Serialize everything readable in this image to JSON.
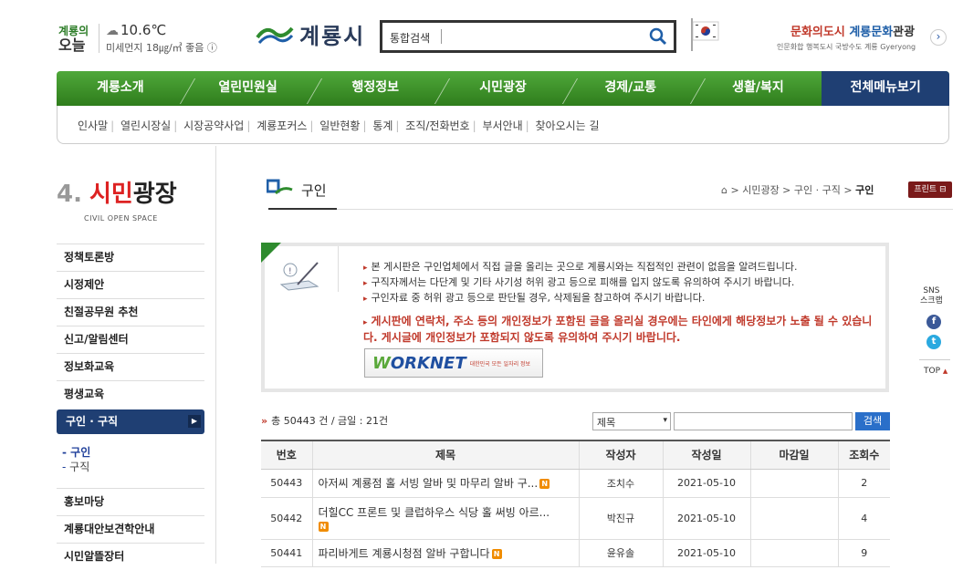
{
  "header": {
    "weather_city": "계룡의",
    "weather_today": "오늘",
    "temperature": "10.6℃",
    "dust": "미세먼지 18㎍/㎥ 좋음 ⓘ",
    "logo_text": "계룡시",
    "search_placeholder": "통합검색",
    "tour_line1_a": "문화의도시 ",
    "tour_line1_b": "계룡문화",
    "tour_line1_c": "관광",
    "tour_line2": "인문화합 행복도시 국방수도 계룡  Gyeryong"
  },
  "menu": [
    "계룡소개",
    "열린민원실",
    "행정정보",
    "시민광장",
    "경제/교통",
    "생활/복지",
    "전체메뉴보기"
  ],
  "submenu": [
    "인사말",
    "열린시장실",
    "시장공약사업",
    "계룡포커스",
    "일반현황",
    "통계",
    "조직/전화번호",
    "부서안내",
    "찾아오시는 길"
  ],
  "section": {
    "number": "4.",
    "title_red": "시민",
    "title_black": "광장",
    "english": "CIVIL OPEN SPACE"
  },
  "left_menu": [
    "정책토론방",
    "시정제안",
    "친절공무원 추천",
    "신고/알림센터",
    "정보화교육",
    "평생교육"
  ],
  "left_active": "구인 · 구직",
  "left_sub": [
    "구인",
    "구직"
  ],
  "left_menu_bottom": [
    "홍보마당",
    "계룡대안보견학안내",
    "시민알뜰장터"
  ],
  "content": {
    "title": "구인",
    "breadcrumb_1": "시민광장",
    "breadcrumb_2": "구인 · 구직",
    "breadcrumb_3": "구인",
    "print_label": "프린트 ⊟"
  },
  "notice": {
    "lines": [
      "본 게시판은 구인업체에서 직접 글을 올리는 곳으로 계룡시와는 직접적인 관련이 없음을 알려드립니다.",
      "구직자께서는 다단계 및 기타 사기성 허위 광고 등으로 피해를 입지 않도록 유의하여 주시기 바랍니다.",
      "구인자료 중 허위 광고 등으로 판단될 경우, 삭제됨을 참고하여 주시기 바랍니다."
    ],
    "warning": "게시판에 연락처, 주소 등의 개인정보가 포함된 글을 올리실 경우에는 타인에게 해당정보가 노출 될 수 있습니다. 게시글에 개인정보가 포함되지 않도록 유의하여 주시기 바랍니다.",
    "worknet_logo": "ORKNET",
    "worknet_sub": "대한민국 모든 일자리 정보"
  },
  "board": {
    "total": "총 50443 건 / 금일 : 21건",
    "select_value": "제목",
    "search_button": "검색",
    "columns": [
      "번호",
      "제목",
      "작성자",
      "작성일",
      "마감일",
      "조회수"
    ],
    "rows": [
      {
        "no": "50443",
        "title": "아저씨 계룡점 홀 서빙 알바 및 마무리 알바 구...",
        "author": "조치수",
        "date": "2021-05-10",
        "deadline": "",
        "views": "2"
      },
      {
        "no": "50442",
        "title": "더힐CC 프론트 및 클럽하우스 식당 홀 써빙 아르...",
        "author": "박진규",
        "date": "2021-05-10",
        "deadline": "",
        "views": "4"
      },
      {
        "no": "50441",
        "title": "파리바게트 계룡시청점 알바 구합니다",
        "author": "윤유솔",
        "date": "2021-05-10",
        "deadline": "",
        "views": "9"
      }
    ],
    "new_badge": "N"
  },
  "side": {
    "sns": "SNS\n스크랩",
    "fb": "f",
    "tw": "t",
    "top": "TOP"
  }
}
